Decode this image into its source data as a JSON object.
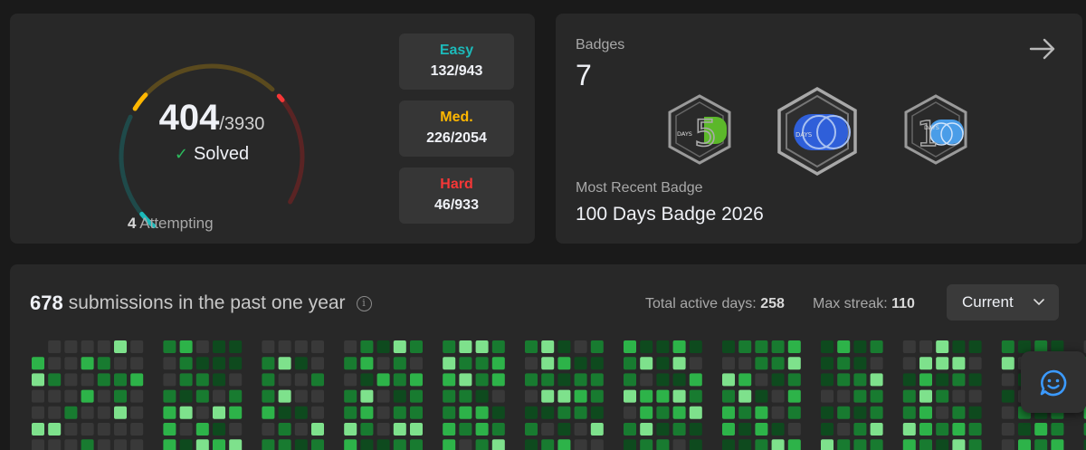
{
  "solved": {
    "count": "404",
    "total": "/3930",
    "label": "Solved",
    "attempting_count": "4",
    "attempting_label": "Attempting",
    "progress": {
      "easy": 0.14,
      "medium": 0.11,
      "hard": 0.05
    },
    "colors": {
      "easy": "#1cbaba",
      "medium": "#ffb700",
      "hard": "#f63737"
    }
  },
  "difficulty": [
    {
      "name": "Easy",
      "value": "132/943",
      "color": "#1cbaba"
    },
    {
      "name": "Med.",
      "value": "226/2054",
      "color": "#ffb700"
    },
    {
      "name": "Hard",
      "value": "46/933",
      "color": "#f63737"
    }
  ],
  "badges": {
    "label": "Badges",
    "count": "7",
    "items": [
      {
        "icon": "50-days-badge-icon",
        "text": "DAYS",
        "color": "#5cb82a"
      },
      {
        "icon": "100-days-badge-icon",
        "text": "DAYS",
        "color": "#2f5fd9"
      },
      {
        "icon": "100-days-badge-icon",
        "text": "DAYS",
        "color": "#4a9de8"
      }
    ],
    "recent_label": "Most Recent Badge",
    "recent_name": "100 Days Badge 2026"
  },
  "heatmap": {
    "count": "678",
    "title_text": "submissions in the past one year",
    "active_days_label": "Total active days:",
    "active_days": "258",
    "max_streak_label": "Max streak:",
    "max_streak": "110",
    "select_value": "Current",
    "colors": [
      "#393939",
      "#0e4a1e",
      "#187b30",
      "#2db349",
      "#7ee18c"
    ]
  }
}
